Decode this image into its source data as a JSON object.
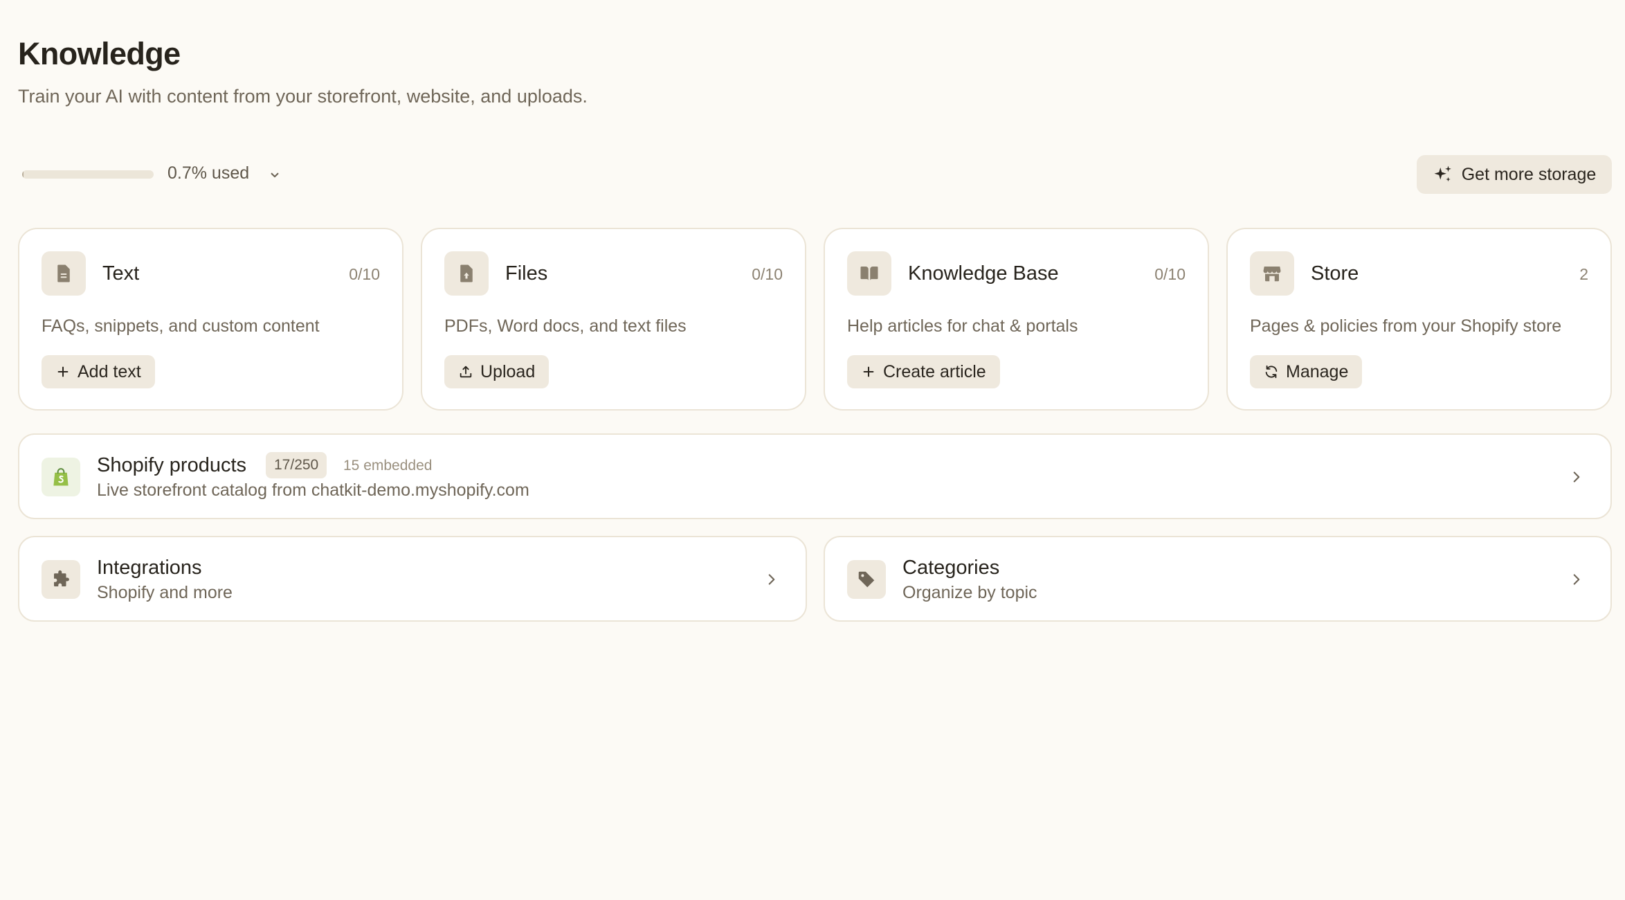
{
  "header": {
    "title": "Knowledge",
    "subtitle": "Train your AI with content from your storefront, website, and uploads."
  },
  "usage": {
    "percent_used": 0.7,
    "label": "0.7% used",
    "storage_button_label": "Get more storage"
  },
  "cards": [
    {
      "title": "Text",
      "count": "0/10",
      "description": "FAQs, snippets, and custom content",
      "button_label": "Add text",
      "icon": "document-icon",
      "button_icon": "plus-icon"
    },
    {
      "title": "Files",
      "count": "0/10",
      "description": "PDFs, Word docs, and text files",
      "button_label": "Upload",
      "icon": "file-upload-icon",
      "button_icon": "upload-icon"
    },
    {
      "title": "Knowledge Base",
      "count": "0/10",
      "description": "Help articles for chat & portals",
      "button_label": "Create article",
      "icon": "book-icon",
      "button_icon": "plus-icon"
    },
    {
      "title": "Store",
      "count": "2",
      "description": "Pages & policies from your Shopify store",
      "button_label": "Manage",
      "icon": "storefront-icon",
      "button_icon": "refresh-icon"
    }
  ],
  "shopify": {
    "title": "Shopify products",
    "badge": "17/250",
    "embedded": "15 embedded",
    "subtitle": "Live storefront catalog from chatkit-demo.myshopify.com"
  },
  "integrations": {
    "title": "Integrations",
    "subtitle": "Shopify and more"
  },
  "categories": {
    "title": "Categories",
    "subtitle": "Organize by topic"
  },
  "colors": {
    "background": "#fcfaf5",
    "card_border": "#ebe4d6",
    "chip": "#efe9de",
    "shopify_green": "#95bf47"
  }
}
